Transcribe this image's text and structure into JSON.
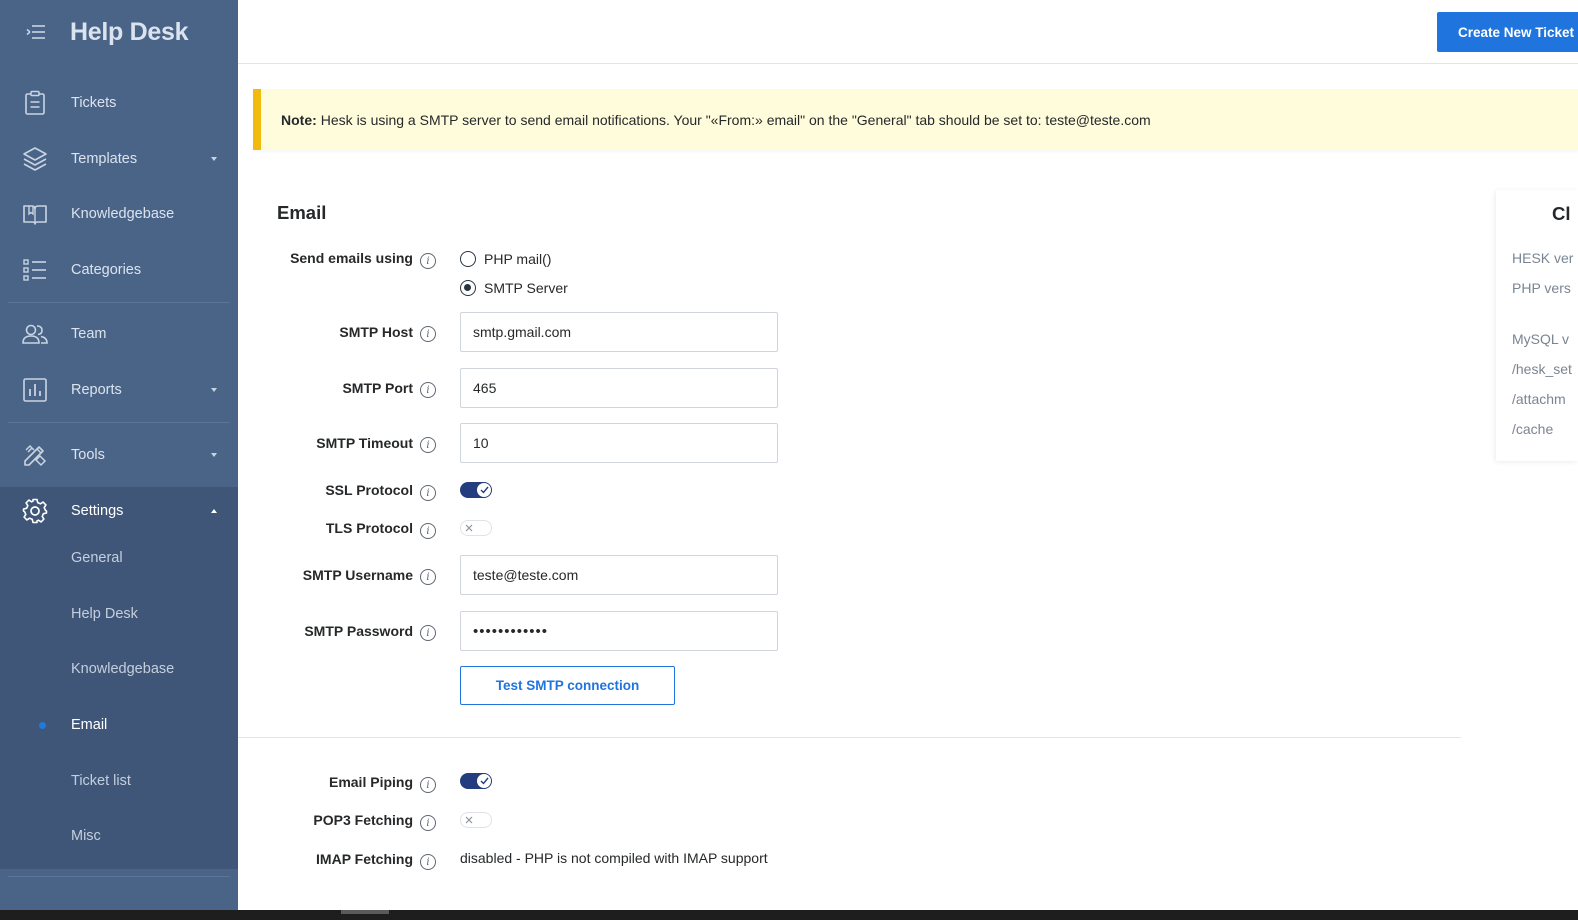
{
  "app": {
    "title": "Help Desk",
    "create_button": "Create New Ticket"
  },
  "sidebar": {
    "items": [
      {
        "label": "Tickets",
        "icon": "clipboard-icon"
      },
      {
        "label": "Templates",
        "icon": "layers-icon",
        "has_caret": true
      },
      {
        "label": "Knowledgebase",
        "icon": "book-icon"
      },
      {
        "label": "Categories",
        "icon": "list-icon"
      },
      {
        "label": "Team",
        "icon": "team-icon"
      },
      {
        "label": "Reports",
        "icon": "chart-icon",
        "has_caret": true
      },
      {
        "label": "Tools",
        "icon": "tools-icon",
        "has_caret": true
      },
      {
        "label": "Settings",
        "icon": "gear-icon",
        "has_caret": true,
        "expanded": true
      }
    ],
    "settings_sub": [
      "General",
      "Help Desk",
      "Knowledgebase",
      "Email",
      "Ticket list",
      "Misc"
    ],
    "active_sub": "Email"
  },
  "note": {
    "prefix": "Note:",
    "text": "Hesk is using a SMTP server to send email notifications. Your \"«From:» email\" on the \"General\" tab should be set to: teste@teste.com"
  },
  "email": {
    "section_title": "Email",
    "send_using_label": "Send emails using",
    "options": [
      "PHP mail()",
      "SMTP Server"
    ],
    "selected_option": "SMTP Server",
    "smtp_host_label": "SMTP Host",
    "smtp_host_value": "smtp.gmail.com",
    "smtp_port_label": "SMTP Port",
    "smtp_port_value": "465",
    "smtp_timeout_label": "SMTP Timeout",
    "smtp_timeout_value": "10",
    "ssl_label": "SSL Protocol",
    "ssl_enabled": true,
    "tls_label": "TLS Protocol",
    "tls_enabled": false,
    "smtp_username_label": "SMTP Username",
    "smtp_username_value": "teste@teste.com",
    "smtp_password_label": "SMTP Password",
    "smtp_password_value": "••••••••••••",
    "test_button": "Test SMTP connection",
    "piping_label": "Email Piping",
    "piping_enabled": true,
    "pop3_label": "POP3 Fetching",
    "pop3_enabled": false,
    "imap_label": "IMAP Fetching",
    "imap_status": "disabled - PHP is not compiled with IMAP support"
  },
  "right_panel": {
    "title": "Cl",
    "lines": [
      "HESK ver",
      "PHP vers",
      "MySQL v",
      "/hesk_set",
      "/attachm",
      "/cache"
    ]
  },
  "colors": {
    "sidebar_bg": "#4a6488",
    "settings_bg": "#3f5678",
    "accent": "#1f74de",
    "toggle_on": "#243d7e",
    "note_bg": "#fffcdc",
    "note_border": "#f2b90f"
  }
}
